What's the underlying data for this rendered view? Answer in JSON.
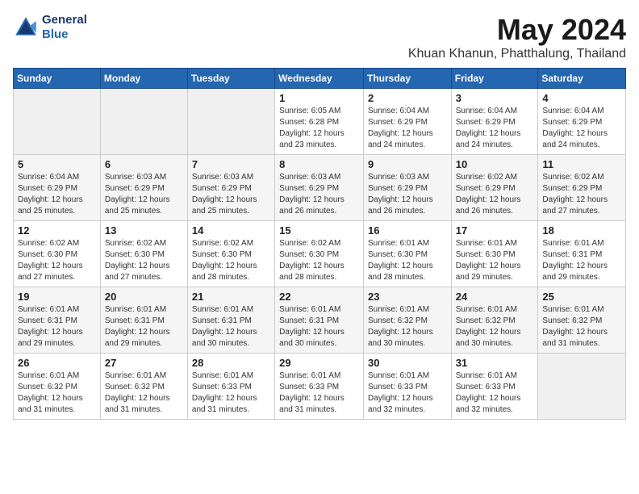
{
  "header": {
    "logo_line1": "General",
    "logo_line2": "Blue",
    "month": "May 2024",
    "location": "Khuan Khanun, Phatthalung, Thailand"
  },
  "weekdays": [
    "Sunday",
    "Monday",
    "Tuesday",
    "Wednesday",
    "Thursday",
    "Friday",
    "Saturday"
  ],
  "weeks": [
    [
      {
        "day": "",
        "info": ""
      },
      {
        "day": "",
        "info": ""
      },
      {
        "day": "",
        "info": ""
      },
      {
        "day": "1",
        "info": "Sunrise: 6:05 AM\nSunset: 6:28 PM\nDaylight: 12 hours\nand 23 minutes."
      },
      {
        "day": "2",
        "info": "Sunrise: 6:04 AM\nSunset: 6:29 PM\nDaylight: 12 hours\nand 24 minutes."
      },
      {
        "day": "3",
        "info": "Sunrise: 6:04 AM\nSunset: 6:29 PM\nDaylight: 12 hours\nand 24 minutes."
      },
      {
        "day": "4",
        "info": "Sunrise: 6:04 AM\nSunset: 6:29 PM\nDaylight: 12 hours\nand 24 minutes."
      }
    ],
    [
      {
        "day": "5",
        "info": "Sunrise: 6:04 AM\nSunset: 6:29 PM\nDaylight: 12 hours\nand 25 minutes."
      },
      {
        "day": "6",
        "info": "Sunrise: 6:03 AM\nSunset: 6:29 PM\nDaylight: 12 hours\nand 25 minutes."
      },
      {
        "day": "7",
        "info": "Sunrise: 6:03 AM\nSunset: 6:29 PM\nDaylight: 12 hours\nand 25 minutes."
      },
      {
        "day": "8",
        "info": "Sunrise: 6:03 AM\nSunset: 6:29 PM\nDaylight: 12 hours\nand 26 minutes."
      },
      {
        "day": "9",
        "info": "Sunrise: 6:03 AM\nSunset: 6:29 PM\nDaylight: 12 hours\nand 26 minutes."
      },
      {
        "day": "10",
        "info": "Sunrise: 6:02 AM\nSunset: 6:29 PM\nDaylight: 12 hours\nand 26 minutes."
      },
      {
        "day": "11",
        "info": "Sunrise: 6:02 AM\nSunset: 6:29 PM\nDaylight: 12 hours\nand 27 minutes."
      }
    ],
    [
      {
        "day": "12",
        "info": "Sunrise: 6:02 AM\nSunset: 6:30 PM\nDaylight: 12 hours\nand 27 minutes."
      },
      {
        "day": "13",
        "info": "Sunrise: 6:02 AM\nSunset: 6:30 PM\nDaylight: 12 hours\nand 27 minutes."
      },
      {
        "day": "14",
        "info": "Sunrise: 6:02 AM\nSunset: 6:30 PM\nDaylight: 12 hours\nand 28 minutes."
      },
      {
        "day": "15",
        "info": "Sunrise: 6:02 AM\nSunset: 6:30 PM\nDaylight: 12 hours\nand 28 minutes."
      },
      {
        "day": "16",
        "info": "Sunrise: 6:01 AM\nSunset: 6:30 PM\nDaylight: 12 hours\nand 28 minutes."
      },
      {
        "day": "17",
        "info": "Sunrise: 6:01 AM\nSunset: 6:30 PM\nDaylight: 12 hours\nand 29 minutes."
      },
      {
        "day": "18",
        "info": "Sunrise: 6:01 AM\nSunset: 6:31 PM\nDaylight: 12 hours\nand 29 minutes."
      }
    ],
    [
      {
        "day": "19",
        "info": "Sunrise: 6:01 AM\nSunset: 6:31 PM\nDaylight: 12 hours\nand 29 minutes."
      },
      {
        "day": "20",
        "info": "Sunrise: 6:01 AM\nSunset: 6:31 PM\nDaylight: 12 hours\nand 29 minutes."
      },
      {
        "day": "21",
        "info": "Sunrise: 6:01 AM\nSunset: 6:31 PM\nDaylight: 12 hours\nand 30 minutes."
      },
      {
        "day": "22",
        "info": "Sunrise: 6:01 AM\nSunset: 6:31 PM\nDaylight: 12 hours\nand 30 minutes."
      },
      {
        "day": "23",
        "info": "Sunrise: 6:01 AM\nSunset: 6:32 PM\nDaylight: 12 hours\nand 30 minutes."
      },
      {
        "day": "24",
        "info": "Sunrise: 6:01 AM\nSunset: 6:32 PM\nDaylight: 12 hours\nand 30 minutes."
      },
      {
        "day": "25",
        "info": "Sunrise: 6:01 AM\nSunset: 6:32 PM\nDaylight: 12 hours\nand 31 minutes."
      }
    ],
    [
      {
        "day": "26",
        "info": "Sunrise: 6:01 AM\nSunset: 6:32 PM\nDaylight: 12 hours\nand 31 minutes."
      },
      {
        "day": "27",
        "info": "Sunrise: 6:01 AM\nSunset: 6:32 PM\nDaylight: 12 hours\nand 31 minutes."
      },
      {
        "day": "28",
        "info": "Sunrise: 6:01 AM\nSunset: 6:33 PM\nDaylight: 12 hours\nand 31 minutes."
      },
      {
        "day": "29",
        "info": "Sunrise: 6:01 AM\nSunset: 6:33 PM\nDaylight: 12 hours\nand 31 minutes."
      },
      {
        "day": "30",
        "info": "Sunrise: 6:01 AM\nSunset: 6:33 PM\nDaylight: 12 hours\nand 32 minutes."
      },
      {
        "day": "31",
        "info": "Sunrise: 6:01 AM\nSunset: 6:33 PM\nDaylight: 12 hours\nand 32 minutes."
      },
      {
        "day": "",
        "info": ""
      }
    ]
  ]
}
